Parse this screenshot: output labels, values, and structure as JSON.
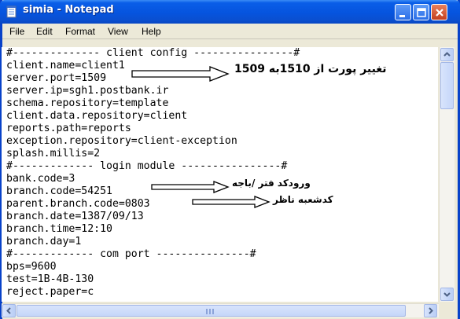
{
  "window": {
    "title": "simia - Notepad"
  },
  "menu": [
    "File",
    "Edit",
    "Format",
    "View",
    "Help"
  ],
  "lines": [
    "#-------------- client config ----------------#",
    "client.name=client1",
    "server.port=1509",
    "server.ip=sgh1.postbank.ir",
    "schema.repository=template",
    "client.data.repository=client",
    "reports.path=reports",
    "exception.repository=client-exception",
    "splash.millis=2",
    "#------------- login module ----------------#",
    "bank.code=3",
    "branch.code=54251",
    "parent.branch.code=0803",
    "branch.date=1387/09/13",
    "branch.time=12:10",
    "branch.day=1",
    "#------------- com port ---------------#",
    "bps=9600",
    "test=1B-4B-130",
    "reject.paper=c"
  ],
  "annotations": {
    "port_change": "تغییر پورت از 1510به 1509",
    "branch_code": "ورودکد فتر /باجه",
    "parent_branch": "کدشعبه ناظر"
  }
}
